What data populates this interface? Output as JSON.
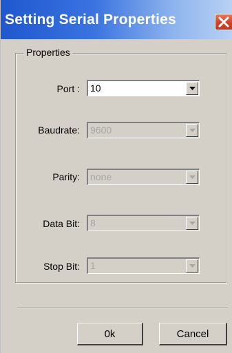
{
  "window": {
    "title": "Setting Serial Properties",
    "title_gradient": [
      "#1f57cf",
      "#b9d1f4"
    ]
  },
  "group": {
    "legend": "Properties"
  },
  "fields": [
    {
      "label": "Port :",
      "value": "10",
      "enabled": true
    },
    {
      "label": "Baudrate:",
      "value": "9600",
      "enabled": false
    },
    {
      "label": "Parity:",
      "value": "none",
      "enabled": false
    },
    {
      "label": "Data Bit:",
      "value": "8",
      "enabled": false
    },
    {
      "label": "Stop Bit:",
      "value": "1",
      "enabled": false
    }
  ],
  "buttons": {
    "ok_label": "0k",
    "cancel_label": "Cancel"
  },
  "icons": {
    "close": "close-icon",
    "dropdown": "chevron-down-icon"
  }
}
